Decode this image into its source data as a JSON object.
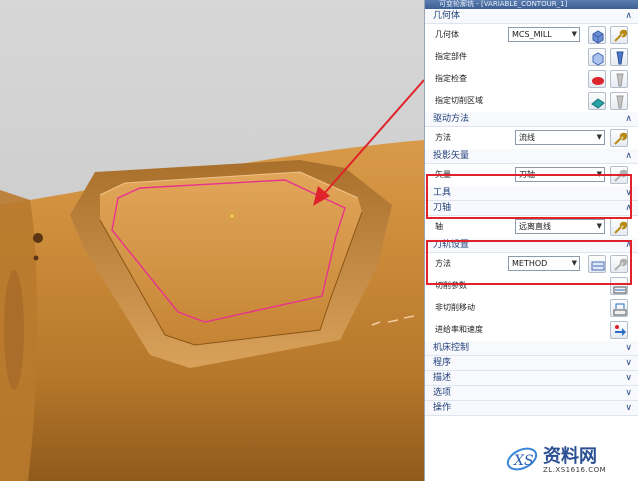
{
  "window": {
    "title": "可变轮廓铣 - [VARIABLE_CONTOUR_1]"
  },
  "sections": {
    "geometry": {
      "header": "几何体",
      "geometry_label": "几何体",
      "geometry_value": "MCS_MILL",
      "part_label": "指定部件",
      "check_label": "指定检查",
      "trim_label": "指定切削区域"
    },
    "drive": {
      "header": "驱动方法",
      "method_label": "方法",
      "method_value": "流线"
    },
    "projection": {
      "header": "投影矢量",
      "vector_label": "矢量",
      "vector_value": "刀轴"
    },
    "tool": {
      "header": "工具"
    },
    "tool_axis": {
      "header": "刀轴",
      "axis_label": "轴",
      "axis_value": "远离直线"
    },
    "path_settings": {
      "header": "刀轨设置",
      "method_label": "方法",
      "method_value": "METHOD",
      "cut_params_label": "切削参数",
      "noncut_label": "非切削移动",
      "feeds_label": "进给率和速度"
    },
    "machine_control": {
      "header": "机床控制"
    },
    "program": {
      "header": "程序"
    },
    "description": {
      "header": "描述"
    },
    "options": {
      "header": "选项"
    },
    "actions": {
      "header": "操作"
    }
  },
  "colors": {
    "part": "#c98a3a",
    "highlight_boundary": "#e8338c",
    "annotation_red": "#e0232a",
    "panel_header_text": "#223f7a"
  },
  "watermark": {
    "text": "资料网",
    "url_text": "ZL.XS1616.COM"
  }
}
